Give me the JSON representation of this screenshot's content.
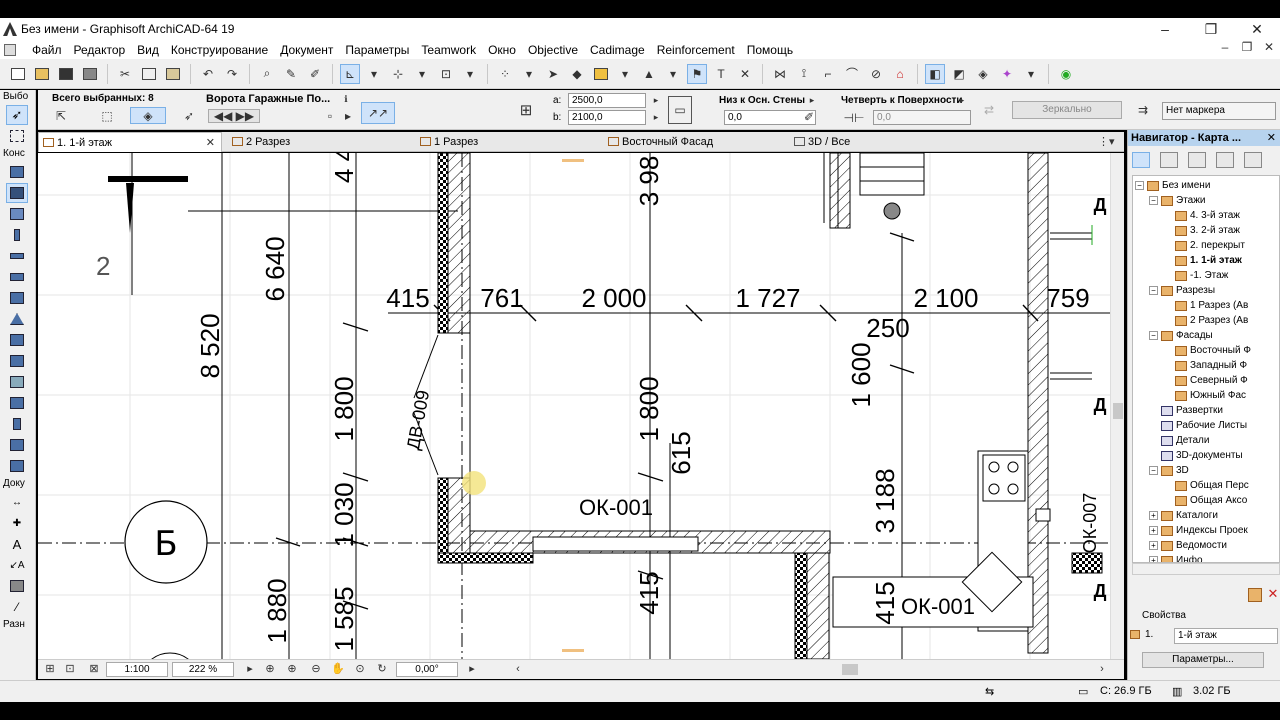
{
  "window": {
    "title": "Без имени - Graphisoft ArchiCAD-64 19"
  },
  "menu": [
    "Файл",
    "Редактор",
    "Вид",
    "Конструирование",
    "Документ",
    "Параметры",
    "Teamwork",
    "Окно",
    "Objective",
    "Cadimage",
    "Reinforcement",
    "Помощь"
  ],
  "toolbox": {
    "groups": [
      "Выбо",
      "Конс",
      "Доку",
      "Разн"
    ]
  },
  "infobox": {
    "selected": "Всего выбранных: 8",
    "object_name": "Ворота Гаражные По...",
    "a_label": "a:",
    "a_value": "2500,0",
    "b_label": "b:",
    "b_value": "2100,0",
    "anchor_label": "Низ к Осн. Стены",
    "anchor_value": "0,0",
    "reveal_label": "Четверть к Поверхности",
    "reveal_value": "0,0",
    "mirror_button": "Зеркально",
    "marker_value": "Нет маркера"
  },
  "tabs": [
    {
      "label": "1. 1-й этаж",
      "active": true
    },
    {
      "label": "2 Разрез"
    },
    {
      "label": "1 Разрез"
    },
    {
      "label": "Восточный Фасад"
    },
    {
      "label": "3D / Все"
    }
  ],
  "drawing": {
    "dims_top": [
      "415",
      "761",
      "2 000",
      "1 727",
      "2 100",
      "759"
    ],
    "dim_250": "250",
    "dims_vertical": [
      "8 520",
      "6 640",
      "4 4",
      "1 800",
      "1 030",
      "1 880",
      "1 585",
      "3 98",
      "1 800",
      "615",
      "415",
      "1 600",
      "3 188",
      "415"
    ],
    "labels": [
      "ОК-001",
      "ОК-001",
      "ДВ-009",
      "ОК-007"
    ],
    "axis_label": "Б",
    "floor_number": "2",
    "edge_marks": [
      "Д",
      "Д",
      "Д"
    ]
  },
  "status_nav": {
    "scale": "1:100",
    "zoom": "222 %",
    "angle": "0,00°"
  },
  "statusbar": {
    "disk": "С: 26.9 ГБ",
    "ram": "3.02 ГБ"
  },
  "navigator": {
    "title": "Навигатор - Карта ...",
    "tree": [
      {
        "label": "Без имени",
        "level": 0,
        "exp": "−"
      },
      {
        "label": "Этажи",
        "level": 1,
        "exp": "−"
      },
      {
        "label": "4. 3-й этаж",
        "level": 2
      },
      {
        "label": "3. 2-й этаж",
        "level": 2
      },
      {
        "label": "2. перекрыт",
        "level": 2
      },
      {
        "label": "1. 1-й этаж",
        "level": 2,
        "bold": true
      },
      {
        "label": "-1. Этаж",
        "level": 2
      },
      {
        "label": "Разрезы",
        "level": 1,
        "exp": "−"
      },
      {
        "label": "1 Разрез (Ав",
        "level": 2
      },
      {
        "label": "2 Разрез (Ав",
        "level": 2
      },
      {
        "label": "Фасады",
        "level": 1,
        "exp": "−"
      },
      {
        "label": "Восточный Ф",
        "level": 2
      },
      {
        "label": "Западный Ф",
        "level": 2
      },
      {
        "label": "Северный Ф",
        "level": 2
      },
      {
        "label": "Южный Фас",
        "level": 2
      },
      {
        "label": "Развертки",
        "level": 1
      },
      {
        "label": "Рабочие Листы",
        "level": 1
      },
      {
        "label": "Детали",
        "level": 1
      },
      {
        "label": "3D-документы",
        "level": 1
      },
      {
        "label": "3D",
        "level": 1,
        "exp": "−"
      },
      {
        "label": "Общая Перс",
        "level": 2
      },
      {
        "label": "Общая Аксо",
        "level": 2
      },
      {
        "label": "Каталоги",
        "level": 1,
        "exp": "+"
      },
      {
        "label": "Индексы Проек",
        "level": 1,
        "exp": "+"
      },
      {
        "label": "Ведомости",
        "level": 1,
        "exp": "+"
      },
      {
        "label": "Инфо",
        "level": 1,
        "exp": "+"
      }
    ],
    "props_header": "Свойства",
    "props_num": "1.",
    "props_floor": "1-й этаж",
    "props_button": "Параметры..."
  }
}
